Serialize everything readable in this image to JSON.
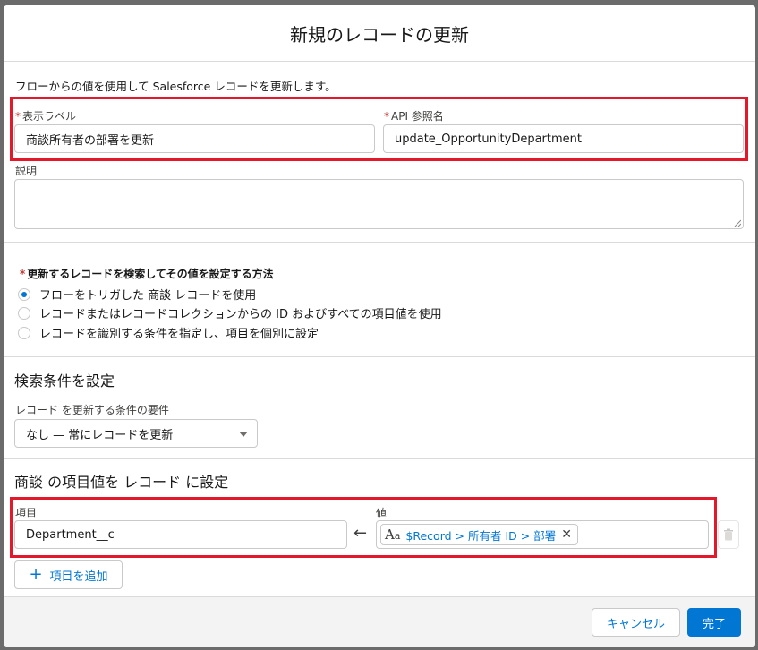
{
  "modal": {
    "title": "新規のレコードの更新",
    "description": "フローからの値を使用して Salesforce レコードを更新します。"
  },
  "fields": {
    "label": {
      "label": "表示ラベル",
      "value": "商談所有者の部署を更新"
    },
    "api_name": {
      "label": "API 参照名",
      "value": "update_OpportunityDepartment"
    },
    "description": {
      "label": "説明",
      "value": ""
    }
  },
  "find_records": {
    "label": "更新するレコードを検索してその値を設定する方法",
    "options": [
      {
        "label": "フローをトリガした 商談 レコードを使用",
        "checked": true
      },
      {
        "label": "レコードまたはレコードコレクションからの ID およびすべての項目値を使用",
        "checked": false
      },
      {
        "label": "レコードを識別する条件を指定し、項目を個別に設定",
        "checked": false
      }
    ]
  },
  "conditions": {
    "heading": "検索条件を設定",
    "requirement_label": "レコード を更新する条件の要件",
    "requirement_value": "なし — 常にレコードを更新"
  },
  "field_values": {
    "heading": "商談 の項目値を レコード に設定",
    "field_label": "項目",
    "value_label": "値",
    "field_value": "Department__c",
    "value_pill": "$Record > 所有者 ID > 部署",
    "add_button": "項目を追加"
  },
  "footer": {
    "cancel": "キャンセル",
    "done": "完了"
  },
  "icons": {
    "arrow": "arrow-left-icon",
    "text_type": "text-type-icon",
    "remove": "close-icon",
    "delete": "trash-icon",
    "add": "plus-icon"
  },
  "colors": {
    "brand": "#0176d3",
    "highlight": "#e3192b",
    "required": "#c23934"
  }
}
